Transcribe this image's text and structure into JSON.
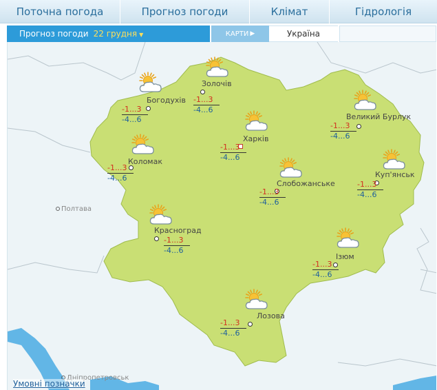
{
  "nav": {
    "tabs": [
      "Поточна погода",
      "Прогноз погоди",
      "Клімат",
      "Гідрологія"
    ]
  },
  "subbar": {
    "label": "Прогноз погоди",
    "date": "22 грудня",
    "maps_button": "КАРТИ",
    "region": "Україна"
  },
  "colors": {
    "region_fill": "#c9df74",
    "water": "#62b6e6",
    "day_temp": "#d22f1f",
    "night_temp": "#1d5f9c",
    "accent": "#2d9bd9"
  },
  "cities": [
    {
      "name": "Золочів",
      "day": "-1...3",
      "night": "-4...6",
      "icon": "partly-cloudy-icon"
    },
    {
      "name": "Богодухів",
      "day": "-1...3",
      "night": "-4...6",
      "icon": "partly-cloudy-icon"
    },
    {
      "name": "Харків",
      "day": "-1...3",
      "night": "-4...6",
      "icon": "partly-cloudy-icon"
    },
    {
      "name": "Великий Бурлук",
      "day": "-1...3",
      "night": "-4...6",
      "icon": "partly-cloudy-icon"
    },
    {
      "name": "Коломак",
      "day": "-1...3",
      "night": "-4...6",
      "icon": "partly-cloudy-icon"
    },
    {
      "name": "Слобожанське",
      "day": "-1...3",
      "night": "-4...6",
      "icon": "partly-cloudy-icon"
    },
    {
      "name": "Куп'янськ",
      "day": "-1...3",
      "night": "-4...6",
      "icon": "partly-cloudy-icon"
    },
    {
      "name": "Красноград",
      "day": "-1...3",
      "night": "-4...6",
      "icon": "partly-cloudy-icon"
    },
    {
      "name": "Ізюм",
      "day": "-1...3",
      "night": "-4...6",
      "icon": "partly-cloudy-icon"
    },
    {
      "name": "Лозова",
      "day": "-1...3",
      "night": "-4...6",
      "icon": "partly-cloudy-icon"
    }
  ],
  "outside_cities": [
    "Полтава",
    "Дніпропетровськ"
  ],
  "legend_link": "Умовні позначки"
}
